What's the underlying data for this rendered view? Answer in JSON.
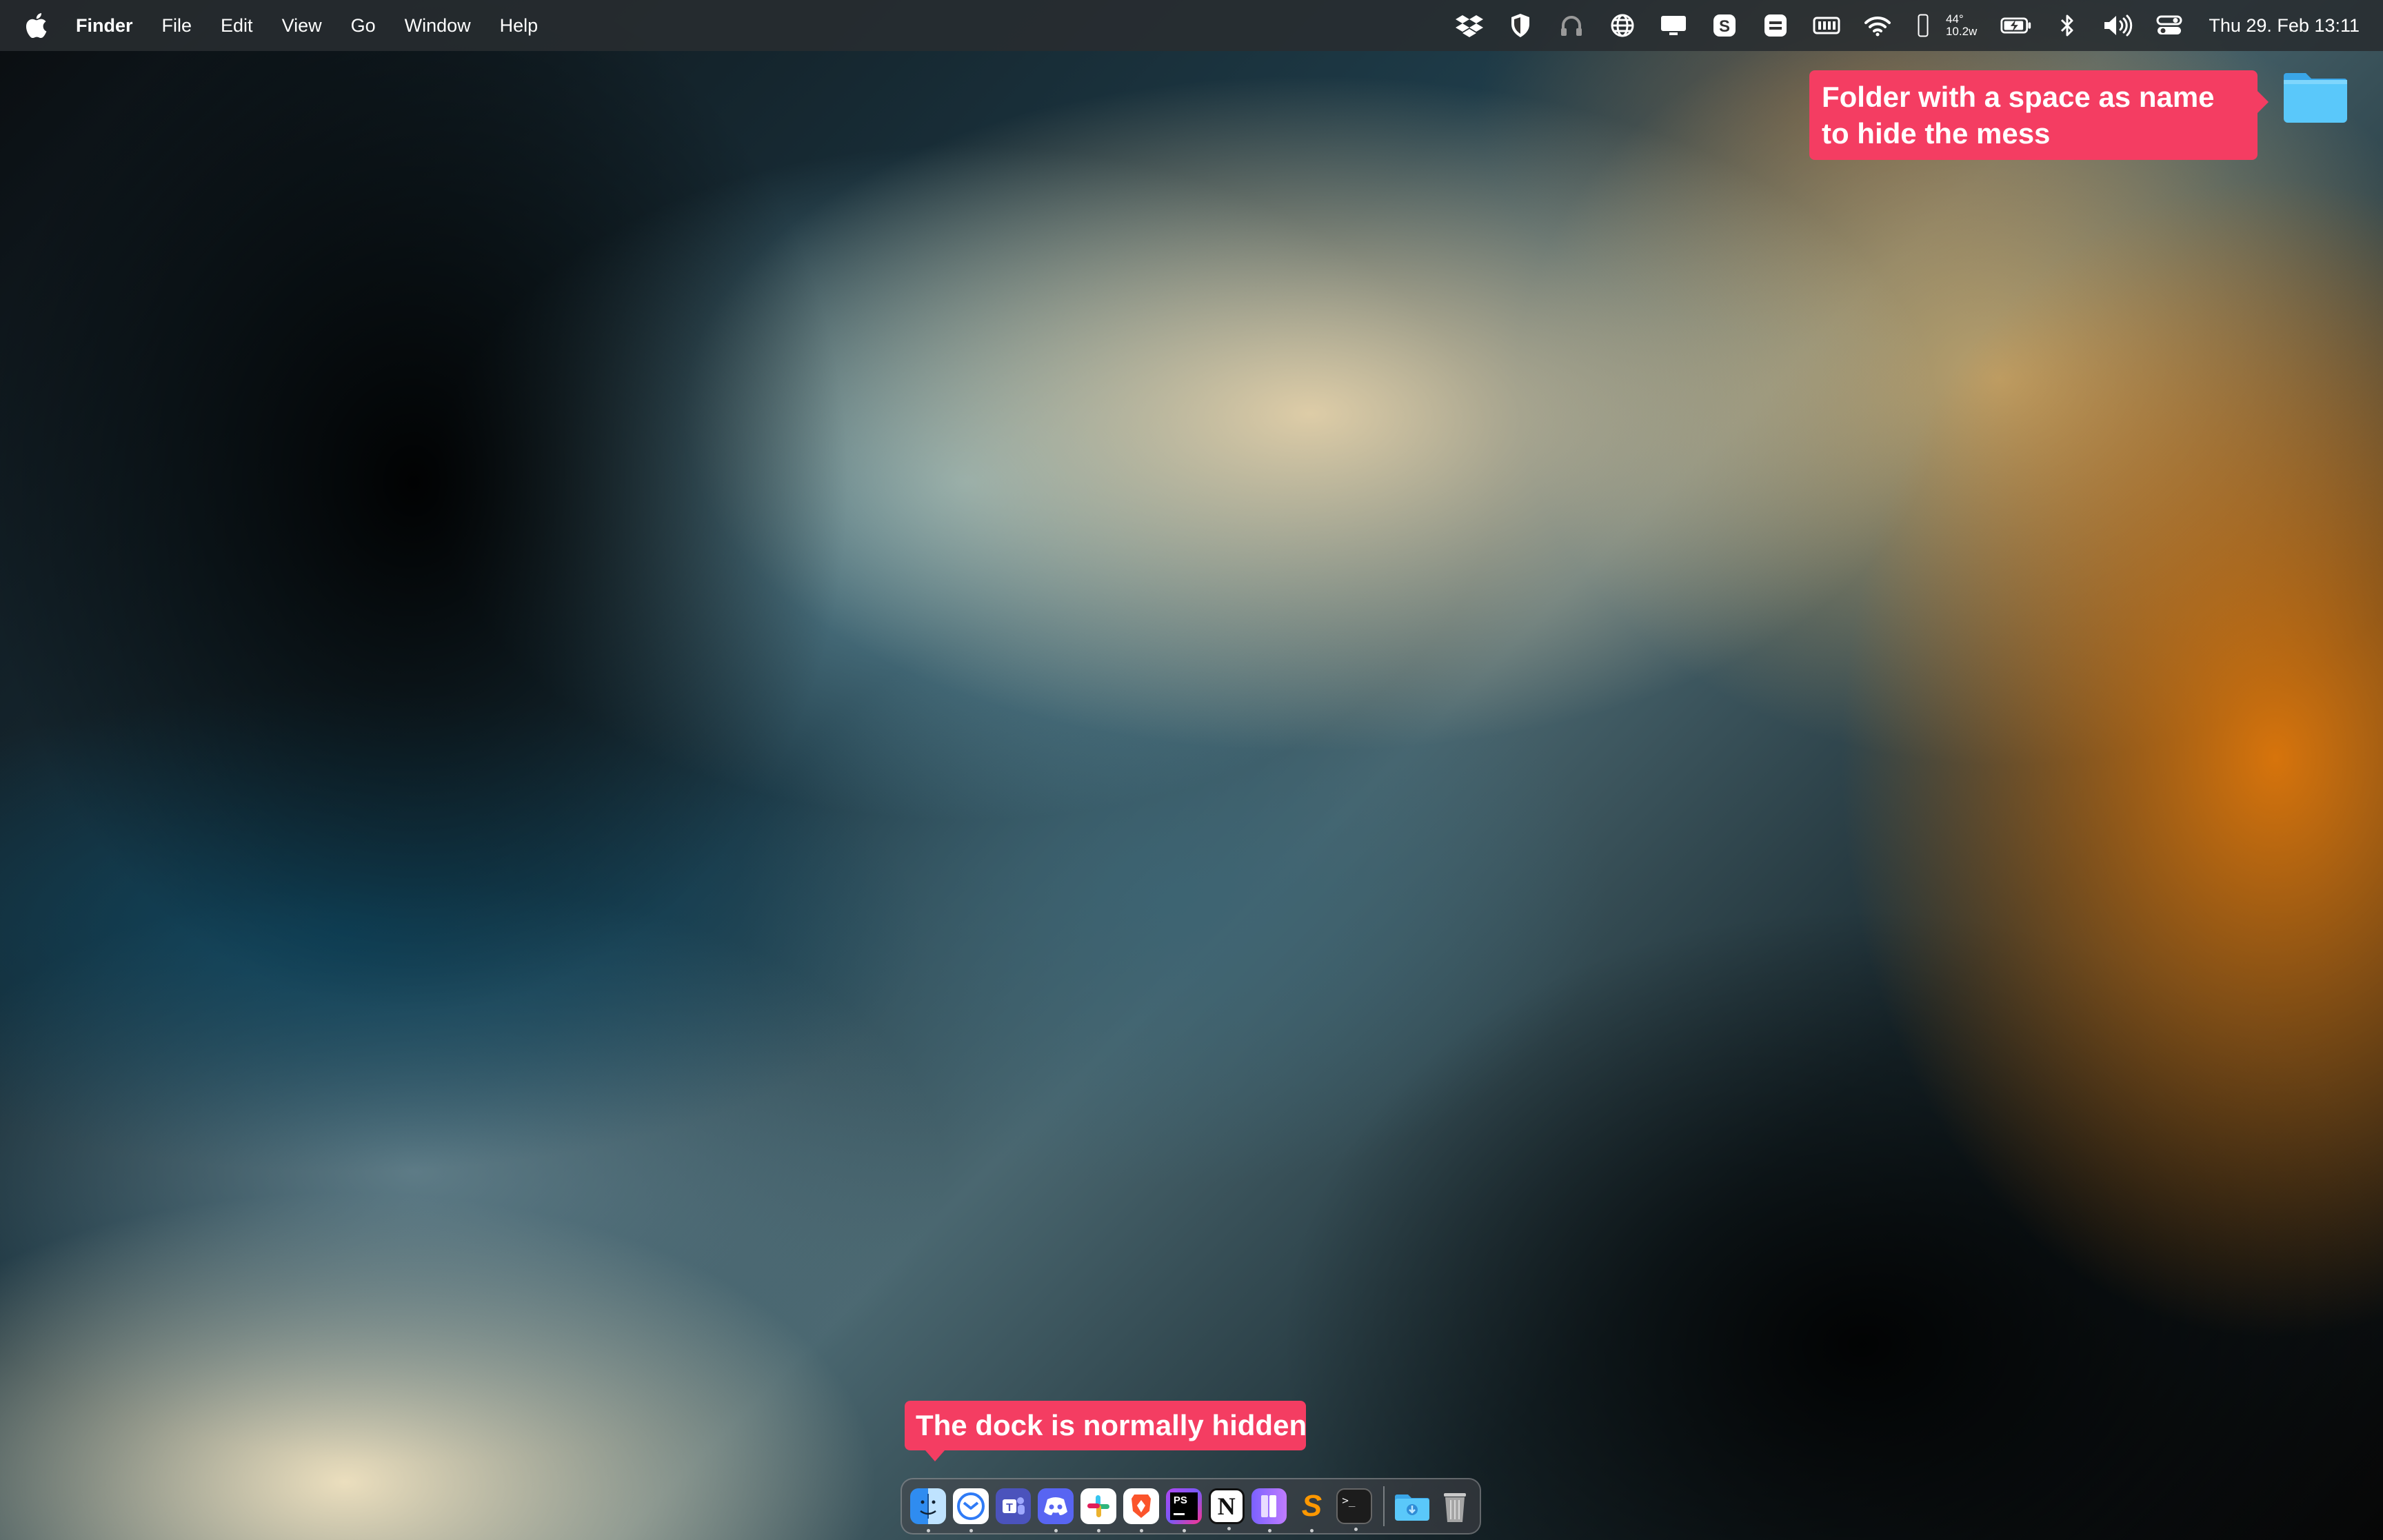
{
  "menubar": {
    "app_name": "Finder",
    "menus": [
      "File",
      "Edit",
      "View",
      "Go",
      "Window",
      "Help"
    ],
    "status_icons": [
      "dropbox-icon",
      "shield-icon",
      "headphones-icon",
      "globe-icon",
      "display-icon",
      "skype-icon",
      "menu-list-icon",
      "memory-icon",
      "wifi-icon",
      "phone-stats-icon",
      "battery-charging-icon",
      "bluetooth-icon",
      "volume-icon",
      "control-center-icon"
    ],
    "stats_top": "44°",
    "stats_bottom": "10.2w",
    "clock": "Thu 29. Feb  13:11"
  },
  "desktop": {
    "folder_icon": "folder-icon",
    "folder_color": "#5ac8fa"
  },
  "annotations": {
    "folder_note": "Folder with a space as name to hide the mess",
    "dock_note": "The dock is normally hidden",
    "color": "#f43d62"
  },
  "dock": {
    "apps": [
      {
        "icon": "finder-icon",
        "running": true
      },
      {
        "icon": "mail-icon",
        "running": true
      },
      {
        "icon": "teams-icon",
        "running": false
      },
      {
        "icon": "discord-icon",
        "running": true
      },
      {
        "icon": "slack-icon",
        "running": true
      },
      {
        "icon": "brave-icon",
        "running": true
      },
      {
        "icon": "phpstorm-icon",
        "running": true
      },
      {
        "icon": "notion-icon",
        "running": true
      },
      {
        "icon": "books-icon",
        "running": true
      },
      {
        "icon": "sublime-text-icon",
        "running": true
      },
      {
        "icon": "terminal-icon",
        "running": true
      }
    ],
    "notion_glyph": "N",
    "sublime_glyph": "S",
    "phpstorm_glyph": "PS",
    "terminal_glyph": ">_",
    "downloads_icon": "downloads-folder-icon",
    "trash_icon": "trash-icon"
  }
}
